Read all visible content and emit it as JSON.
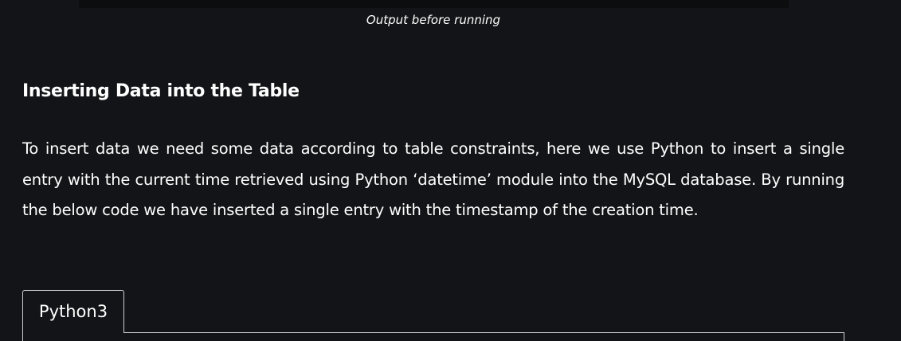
{
  "figure": {
    "caption": "Output before running"
  },
  "section": {
    "heading": "Inserting Data into the Table",
    "paragraph": "To insert data we need some data according to table constraints, here we use Python to insert a single entry with the current time retrieved using Python ‘datetime’ module into the MySQL database. By running the below code we have inserted a single entry with the timestamp of the creation time."
  },
  "code_block": {
    "tabs": [
      {
        "label": "Python3",
        "active": true
      }
    ]
  }
}
